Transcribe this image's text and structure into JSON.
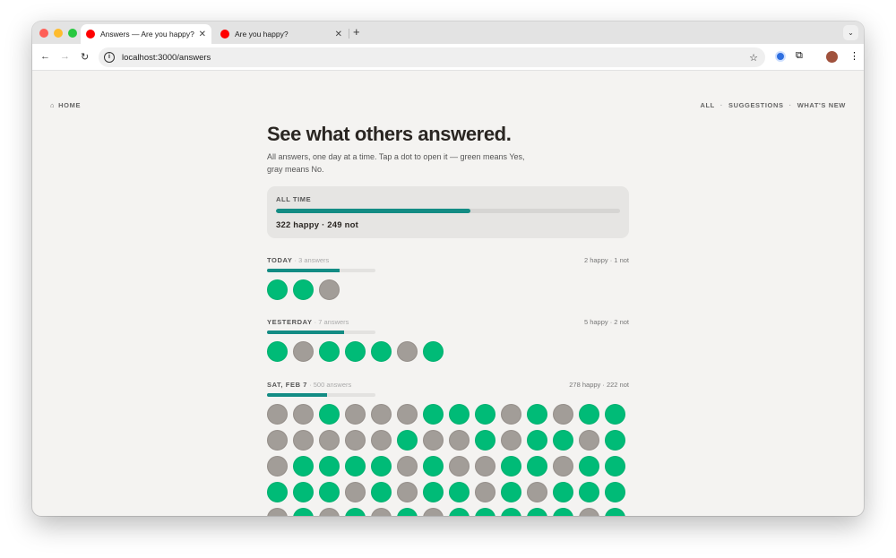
{
  "browser": {
    "tabs": [
      {
        "title": "Answers — Are you happy?",
        "active": true
      },
      {
        "title": "Are you happy?",
        "active": false
      }
    ],
    "url": "localhost:3000/answers"
  },
  "nav": {
    "home": "HOME",
    "links": [
      "ALL",
      "SUGGESTIONS",
      "WHAT'S NEW"
    ],
    "sep": "·"
  },
  "page": {
    "title": "See what others answered.",
    "subtitle": "All answers, one day at a time. Tap a dot to open it — green means Yes, gray means No."
  },
  "all_time": {
    "label": "ALL TIME",
    "happy_fraction": 0.564,
    "summary": "322 happy · 249 not"
  },
  "colors": {
    "yes": "#00bb77",
    "no": "#a29d98",
    "bar": "#138c84"
  },
  "days": [
    {
      "label": "TODAY",
      "count": "· 3 answers",
      "summary": "2 happy · 1 not",
      "happy_fraction": 0.667,
      "answers": [
        1,
        1,
        0
      ]
    },
    {
      "label": "YESTERDAY",
      "count": "· 7 answers",
      "summary": "5 happy · 2 not",
      "happy_fraction": 0.714,
      "answers": [
        1,
        0,
        1,
        1,
        1,
        0,
        1
      ]
    },
    {
      "label": "SAT, FEB 7",
      "count": "· 500 answers",
      "summary": "278 happy · 222 not",
      "happy_fraction": 0.556,
      "answers": [
        0,
        0,
        1,
        0,
        0,
        0,
        1,
        1,
        1,
        0,
        1,
        0,
        1,
        1,
        0,
        0,
        0,
        0,
        0,
        1,
        0,
        0,
        1,
        0,
        1,
        1,
        0,
        1,
        0,
        1,
        1,
        1,
        1,
        0,
        1,
        0,
        0,
        1,
        1,
        0,
        1,
        1,
        1,
        1,
        1,
        0,
        1,
        0,
        1,
        1,
        0,
        1,
        0,
        1,
        1,
        1,
        0,
        1,
        0,
        1,
        0,
        1,
        0,
        1,
        1,
        1,
        1,
        1,
        0,
        1
      ]
    }
  ]
}
